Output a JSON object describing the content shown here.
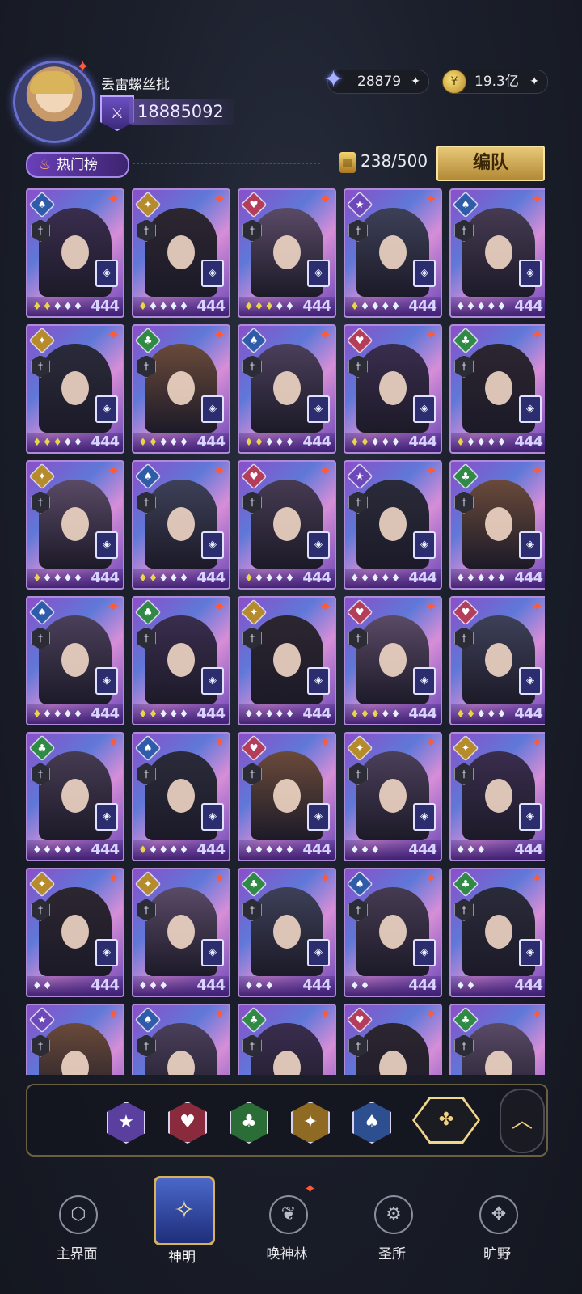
{
  "header": {
    "player_name": "丢雷螺丝批",
    "power": "18885092",
    "gems": "28879",
    "gold": "19.3亿",
    "plus": "✦"
  },
  "filter_row": {
    "hot_tab": "热门榜",
    "capacity": "238/500",
    "team_button": "编队"
  },
  "cards": [
    {
      "suit": "spade",
      "pips_gold": 2,
      "pips_white": 3,
      "level": "444"
    },
    {
      "suit": "diamond",
      "pips_gold": 1,
      "pips_white": 4,
      "level": "444"
    },
    {
      "suit": "heart",
      "pips_gold": 3,
      "pips_white": 2,
      "level": "444"
    },
    {
      "suit": "star",
      "pips_gold": 1,
      "pips_white": 4,
      "level": "444"
    },
    {
      "suit": "spade",
      "pips_gold": 0,
      "pips_white": 5,
      "level": "444"
    },
    {
      "suit": "diamond",
      "pips_gold": 3,
      "pips_white": 2,
      "level": "444"
    },
    {
      "suit": "club",
      "pips_gold": 2,
      "pips_white": 3,
      "level": "444"
    },
    {
      "suit": "spade",
      "pips_gold": 2,
      "pips_white": 3,
      "level": "444"
    },
    {
      "suit": "heart",
      "pips_gold": 2,
      "pips_white": 3,
      "level": "444"
    },
    {
      "suit": "club",
      "pips_gold": 1,
      "pips_white": 4,
      "level": "444"
    },
    {
      "suit": "diamond",
      "pips_gold": 1,
      "pips_white": 4,
      "level": "444"
    },
    {
      "suit": "spade",
      "pips_gold": 2,
      "pips_white": 3,
      "level": "444"
    },
    {
      "suit": "heart",
      "pips_gold": 1,
      "pips_white": 4,
      "level": "444"
    },
    {
      "suit": "star",
      "pips_gold": 0,
      "pips_white": 5,
      "level": "444"
    },
    {
      "suit": "club",
      "pips_gold": 0,
      "pips_white": 5,
      "level": "444"
    },
    {
      "suit": "spade",
      "pips_gold": 1,
      "pips_white": 4,
      "level": "444"
    },
    {
      "suit": "club",
      "pips_gold": 2,
      "pips_white": 3,
      "level": "444"
    },
    {
      "suit": "diamond",
      "pips_gold": 0,
      "pips_white": 5,
      "level": "444"
    },
    {
      "suit": "heart",
      "pips_gold": 3,
      "pips_white": 2,
      "level": "444"
    },
    {
      "suit": "heart",
      "pips_gold": 2,
      "pips_white": 3,
      "level": "444"
    },
    {
      "suit": "club",
      "pips_gold": 0,
      "pips_white": 5,
      "level": "444"
    },
    {
      "suit": "spade",
      "pips_gold": 1,
      "pips_white": 4,
      "level": "444"
    },
    {
      "suit": "heart",
      "pips_gold": 0,
      "pips_white": 5,
      "level": "444"
    },
    {
      "suit": "diamond",
      "pips_gold": 0,
      "pips_white": 3,
      "level": "444"
    },
    {
      "suit": "diamond",
      "pips_gold": 0,
      "pips_white": 3,
      "level": "444"
    },
    {
      "suit": "diamond",
      "pips_gold": 0,
      "pips_white": 2,
      "level": "444"
    },
    {
      "suit": "diamond",
      "pips_gold": 0,
      "pips_white": 3,
      "level": "444"
    },
    {
      "suit": "club",
      "pips_gold": 0,
      "pips_white": 3,
      "level": "444"
    },
    {
      "suit": "spade",
      "pips_gold": 0,
      "pips_white": 2,
      "level": "444"
    },
    {
      "suit": "club",
      "pips_gold": 0,
      "pips_white": 2,
      "level": "444"
    },
    {
      "suit": "star",
      "pips_gold": 0,
      "pips_white": 0,
      "level": ""
    },
    {
      "suit": "spade",
      "pips_gold": 0,
      "pips_white": 0,
      "level": ""
    },
    {
      "suit": "club",
      "pips_gold": 0,
      "pips_white": 0,
      "level": ""
    },
    {
      "suit": "heart",
      "pips_gold": 0,
      "pips_white": 0,
      "level": ""
    },
    {
      "suit": "club",
      "pips_gold": 0,
      "pips_white": 0,
      "level": ""
    }
  ],
  "filters": [
    {
      "name": "star-filter",
      "glyph": "★",
      "color": "#5b3f9e"
    },
    {
      "name": "heart-filter",
      "glyph": "♥",
      "color": "#8a2a3d"
    },
    {
      "name": "club-filter",
      "glyph": "♣",
      "color": "#2b6d37"
    },
    {
      "name": "diamond-filter",
      "glyph": "✦",
      "color": "#8e6a22"
    },
    {
      "name": "spade-filter",
      "glyph": "♠",
      "color": "#2d4f8f"
    }
  ],
  "filter_all_glyph": "✤",
  "collapse_glyph": "︿",
  "nav": [
    {
      "label": "主界面",
      "icon": "home-icon",
      "glyph": "⬡"
    },
    {
      "label": "神明",
      "icon": "god-card-icon",
      "glyph": "✧"
    },
    {
      "label": "唤神林",
      "icon": "summon-tree-icon",
      "glyph": "❦"
    },
    {
      "label": "圣所",
      "icon": "sanctuary-icon",
      "glyph": "⚙"
    },
    {
      "label": "旷野",
      "icon": "wilds-compass-icon",
      "glyph": "✥"
    }
  ]
}
